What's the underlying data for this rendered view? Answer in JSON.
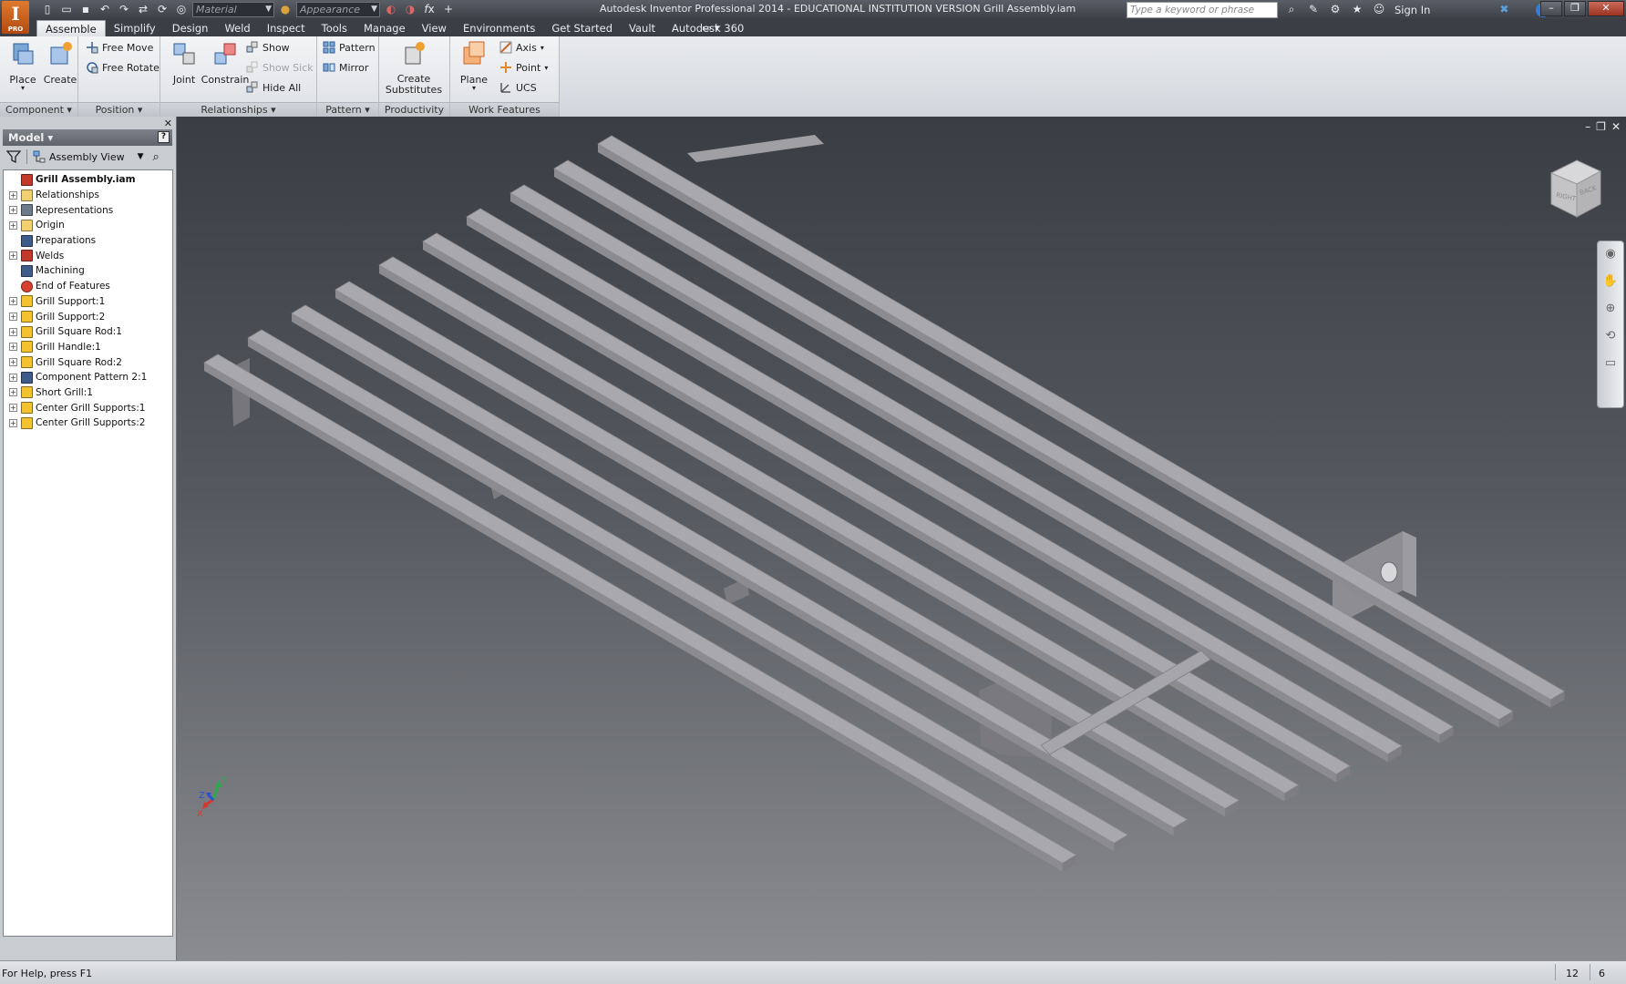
{
  "app": {
    "title": "Autodesk Inventor Professional 2014 - EDUCATIONAL INSTITUTION VERSION    Grill Assembly.iam",
    "logo_letter": "I",
    "logo_sub": "PRO",
    "material_placeholder": "Material",
    "appearance_placeholder": "Appearance",
    "search_placeholder": "Type a keyword or phrase",
    "sign_in": "Sign In"
  },
  "tabs": [
    "Assemble",
    "Simplify",
    "Design",
    "Weld",
    "Inspect",
    "Tools",
    "Manage",
    "View",
    "Environments",
    "Get Started",
    "Vault",
    "Autodesk 360"
  ],
  "ribbon": {
    "component": {
      "title": "Component",
      "place": "Place",
      "create": "Create"
    },
    "position": {
      "title": "Position",
      "free_move": "Free Move",
      "free_rotate": "Free Rotate"
    },
    "relationships": {
      "title": "Relationships",
      "joint": "Joint",
      "constrain": "Constrain",
      "show": "Show",
      "show_sick": "Show Sick",
      "hide_all": "Hide All"
    },
    "pattern": {
      "title": "Pattern",
      "pattern": "Pattern",
      "mirror": "Mirror"
    },
    "productivity": {
      "title": "Productivity",
      "create_substitutes": "Create Substitutes"
    },
    "work_features": {
      "title": "Work Features",
      "plane": "Plane",
      "axis": "Axis",
      "point": "Point",
      "ucs": "UCS"
    }
  },
  "browser": {
    "title": "Model",
    "view": "Assembly View",
    "tree": [
      {
        "label": "Grill Assembly.iam",
        "icon": "assembly-icon",
        "expand": false,
        "root": true
      },
      {
        "label": "Relationships",
        "icon": "folder-icon",
        "expand": true
      },
      {
        "label": "Representations",
        "icon": "representations-icon",
        "expand": true
      },
      {
        "label": "Origin",
        "icon": "folder-icon",
        "expand": true
      },
      {
        "label": "Preparations",
        "icon": "preparations-icon",
        "expand": false
      },
      {
        "label": "Welds",
        "icon": "welds-icon",
        "expand": true
      },
      {
        "label": "Machining",
        "icon": "machining-icon",
        "expand": false
      },
      {
        "label": "End of Features",
        "icon": "end-of-features-icon",
        "expand": false
      },
      {
        "label": "Grill Support:1",
        "icon": "part-icon",
        "expand": true
      },
      {
        "label": "Grill Support:2",
        "icon": "part-icon",
        "expand": true
      },
      {
        "label": "Grill Square Rod:1",
        "icon": "part-icon",
        "expand": true
      },
      {
        "label": "Grill Handle:1",
        "icon": "part-icon",
        "expand": true
      },
      {
        "label": "Grill Square Rod:2",
        "icon": "part-icon",
        "expand": true
      },
      {
        "label": "Component Pattern 2:1",
        "icon": "pattern-icon",
        "expand": true
      },
      {
        "label": "Short Grill:1",
        "icon": "part-icon",
        "expand": true
      },
      {
        "label": "Center Grill Supports:1",
        "icon": "part-icon",
        "expand": true
      },
      {
        "label": "Center Grill Supports:2",
        "icon": "part-icon",
        "expand": true
      }
    ]
  },
  "viewcube": {
    "face_right": "RIGHT",
    "face_back": "BACK"
  },
  "triad": {
    "x": "X",
    "y": "Y",
    "z": "Z"
  },
  "status": {
    "message": "For Help, press F1",
    "n1": "12",
    "n2": "6"
  },
  "colors": {
    "accent": "#e07a2d",
    "viewport_top": "#3a3d44",
    "viewport_bottom": "#8a8c90",
    "model": "#a9a9ad"
  }
}
